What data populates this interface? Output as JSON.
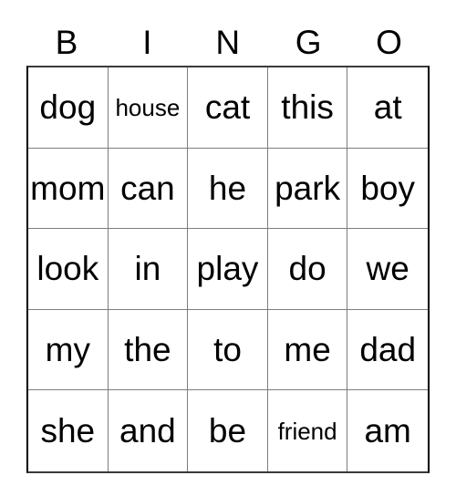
{
  "card": {
    "title": "BINGO",
    "headers": [
      "B",
      "I",
      "N",
      "G",
      "O"
    ],
    "rows": [
      [
        {
          "text": "dog",
          "size": "normal"
        },
        {
          "text": "house",
          "size": "small"
        },
        {
          "text": "cat",
          "size": "normal"
        },
        {
          "text": "this",
          "size": "normal"
        },
        {
          "text": "at",
          "size": "normal"
        }
      ],
      [
        {
          "text": "mom",
          "size": "normal"
        },
        {
          "text": "can",
          "size": "normal"
        },
        {
          "text": "he",
          "size": "normal"
        },
        {
          "text": "park",
          "size": "normal"
        },
        {
          "text": "boy",
          "size": "normal"
        }
      ],
      [
        {
          "text": "look",
          "size": "normal"
        },
        {
          "text": "in",
          "size": "normal"
        },
        {
          "text": "play",
          "size": "normal"
        },
        {
          "text": "do",
          "size": "normal"
        },
        {
          "text": "we",
          "size": "normal"
        }
      ],
      [
        {
          "text": "my",
          "size": "normal"
        },
        {
          "text": "the",
          "size": "normal"
        },
        {
          "text": "to",
          "size": "normal"
        },
        {
          "text": "me",
          "size": "normal"
        },
        {
          "text": "dad",
          "size": "normal"
        }
      ],
      [
        {
          "text": "she",
          "size": "normal"
        },
        {
          "text": "and",
          "size": "normal"
        },
        {
          "text": "be",
          "size": "normal"
        },
        {
          "text": "friend",
          "size": "small"
        },
        {
          "text": "am",
          "size": "normal"
        }
      ]
    ],
    "colors": {
      "background": "#ffffff",
      "text": "#000000",
      "inner_border": "#7d7d7d",
      "outer_border": "#000000"
    }
  }
}
